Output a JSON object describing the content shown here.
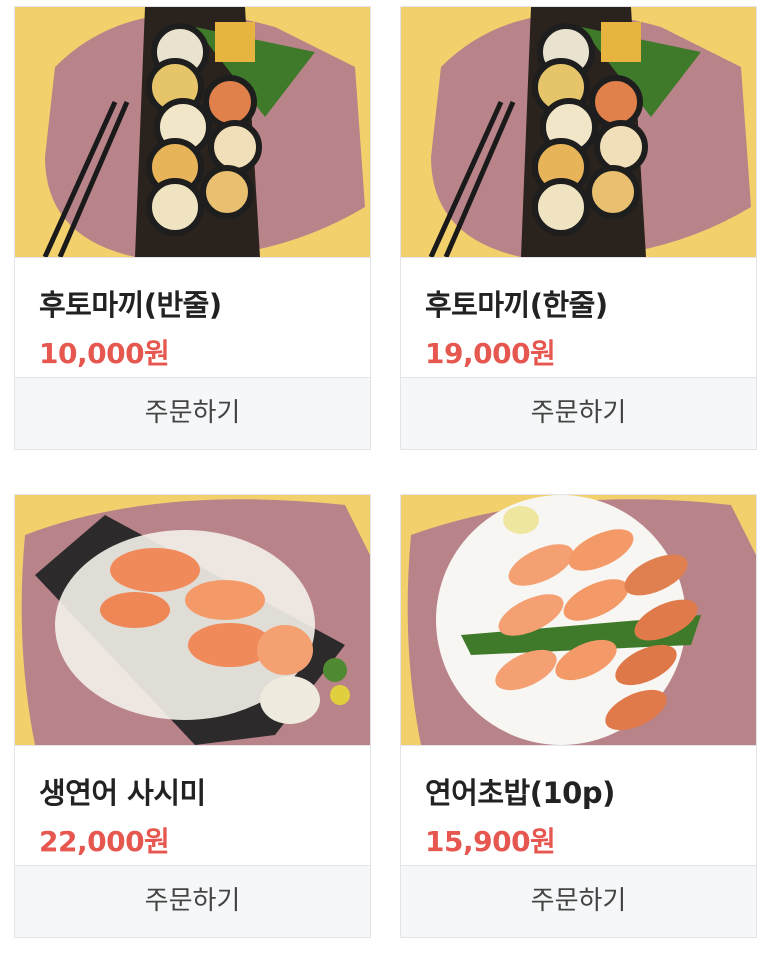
{
  "products": [
    {
      "name": "후토마끼(반줄)",
      "price": "10,000원",
      "order_label": "주문하기",
      "image": "futomaki-half-photo"
    },
    {
      "name": "후토마끼(한줄)",
      "price": "19,000원",
      "order_label": "주문하기",
      "image": "futomaki-full-photo"
    },
    {
      "name": "생연어 사시미",
      "price": "22,000원",
      "order_label": "주문하기",
      "image": "salmon-sashimi-photo"
    },
    {
      "name": "연어초밥(10p)",
      "price": "15,900원",
      "order_label": "주문하기",
      "image": "salmon-sushi-photo"
    }
  ],
  "colors": {
    "price": "#e6574f",
    "background": "#f2d06b",
    "placemat": "#b9838a"
  }
}
